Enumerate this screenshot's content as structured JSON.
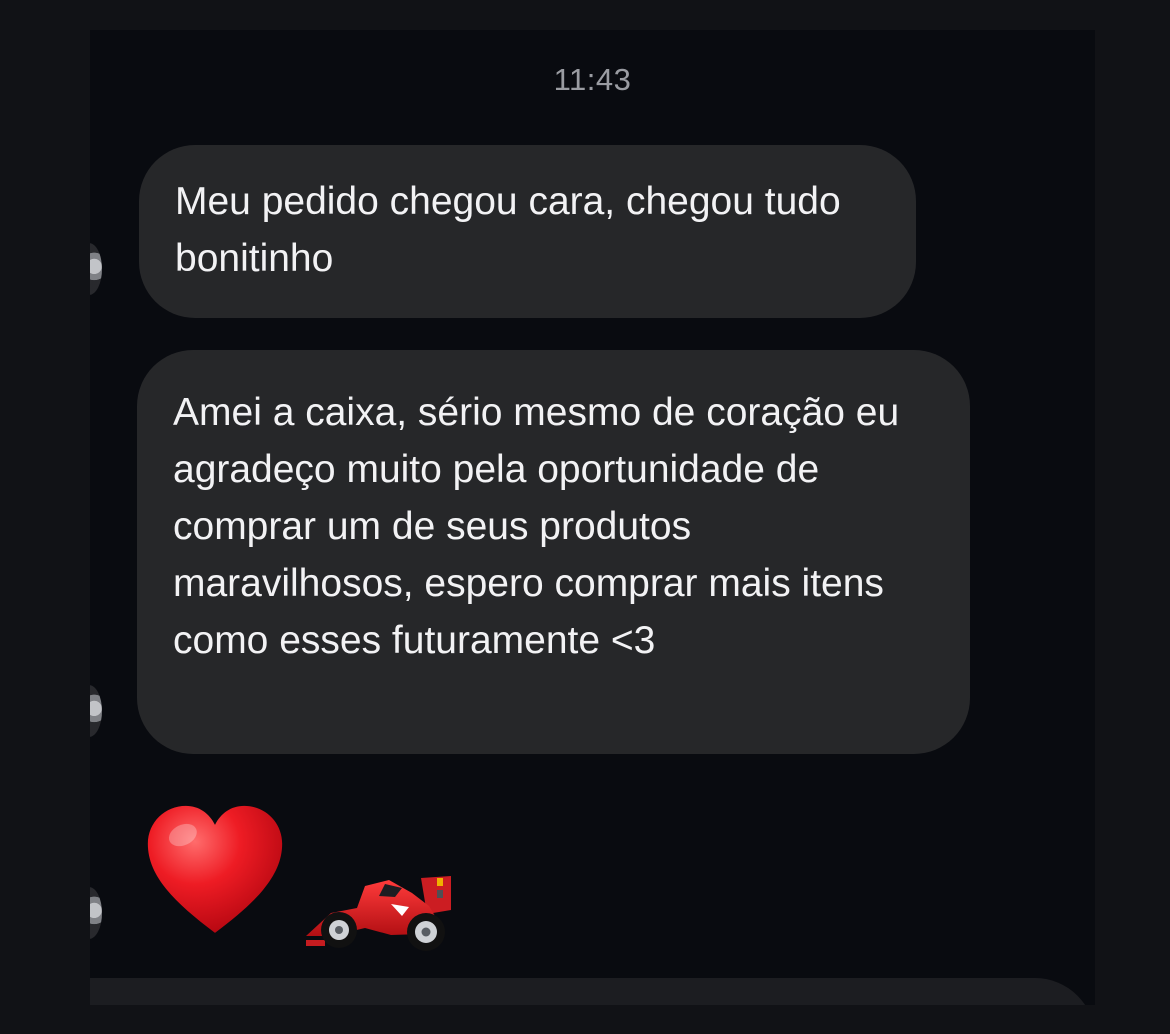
{
  "conversation": {
    "timestamp": "11:43",
    "messages": [
      {
        "text": "Meu pedido chegou cara, chegou tudo bonitinho"
      },
      {
        "text": "Amei a caixa, sério mesmo de coração eu agradeço muito pela oportunidade de comprar um de seus produtos maravilhosos, espero comprar mais itens como esses futuramente <3"
      }
    ],
    "emoji_message": {
      "icons": [
        "heart-icon",
        "race-car-icon"
      ]
    }
  },
  "colors": {
    "background": "#090b10",
    "bubble": "#262729",
    "text": "#f2f2f4",
    "timestamp": "#9a9ca2",
    "heart": "#e3121d",
    "car": "#d91f1f"
  }
}
